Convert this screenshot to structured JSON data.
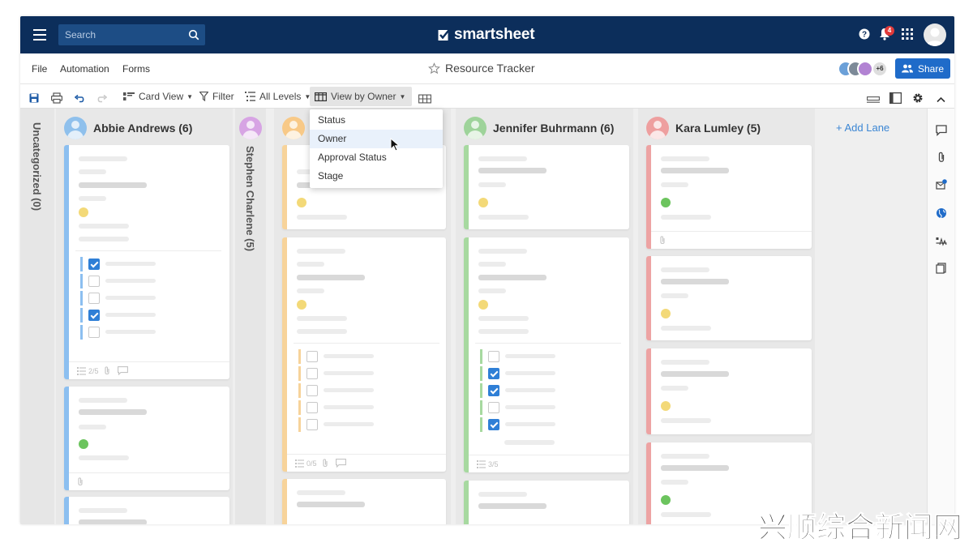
{
  "header": {
    "search_placeholder": "Search",
    "logo_text": "smartsheet",
    "notification_count": "4"
  },
  "menu": {
    "file": "File",
    "automation": "Automation",
    "forms": "Forms",
    "sheet_title": "Resource Tracker",
    "collaborators_more": "+6",
    "share_label": "Share"
  },
  "toolbar": {
    "card_view": "Card View",
    "filter": "Filter",
    "all_levels": "All Levels",
    "view_by": "View by Owner"
  },
  "dropdown": {
    "items": [
      "Status",
      "Owner",
      "Approval Status",
      "Stage"
    ],
    "highlighted": "Owner"
  },
  "lanes": {
    "uncategorized": "Uncategorized (0)",
    "abbie": "Abbie Andrews (6)",
    "stephen": "Stephen Charlene (5)",
    "jennifer": "Jennifer Buhrmann (6)",
    "kara": "Kara Lumley (5)",
    "add_lane": "+ Add Lane"
  },
  "card_counts": {
    "abbie_card1": "2/5",
    "third_card2": "0/5",
    "jennifer_card2": "3/5"
  },
  "colors": {
    "navy": "#0c2e5b",
    "blue_stripe": "#8cbff0",
    "orange_stripe": "#f7d39a",
    "green_stripe": "#a7d9a0",
    "red_stripe": "#eda3a3",
    "yellow_dot": "#f3d978",
    "green_dot": "#6cc45e",
    "share_blue": "#1f6bc9"
  },
  "watermark": "兴顺综合新闻网"
}
